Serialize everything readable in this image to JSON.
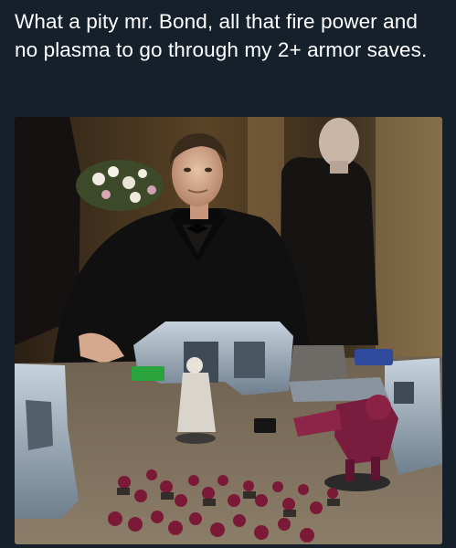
{
  "post": {
    "caption": "What a pity mr. Bond, all that fire power and no plasma to go through my 2+ armor saves.",
    "background_color": "#15202b",
    "text_color": "#ffffff"
  },
  "photo": {
    "subject": "meme-photo-villain-at-tabletop-wargame",
    "elements": [
      "man-in-tuxedo",
      "bald-henchman",
      "flowers",
      "miniature-ruins",
      "red-miniature-army",
      "walker-miniature",
      "white-cloaked-miniature",
      "dice",
      "green-card"
    ]
  }
}
